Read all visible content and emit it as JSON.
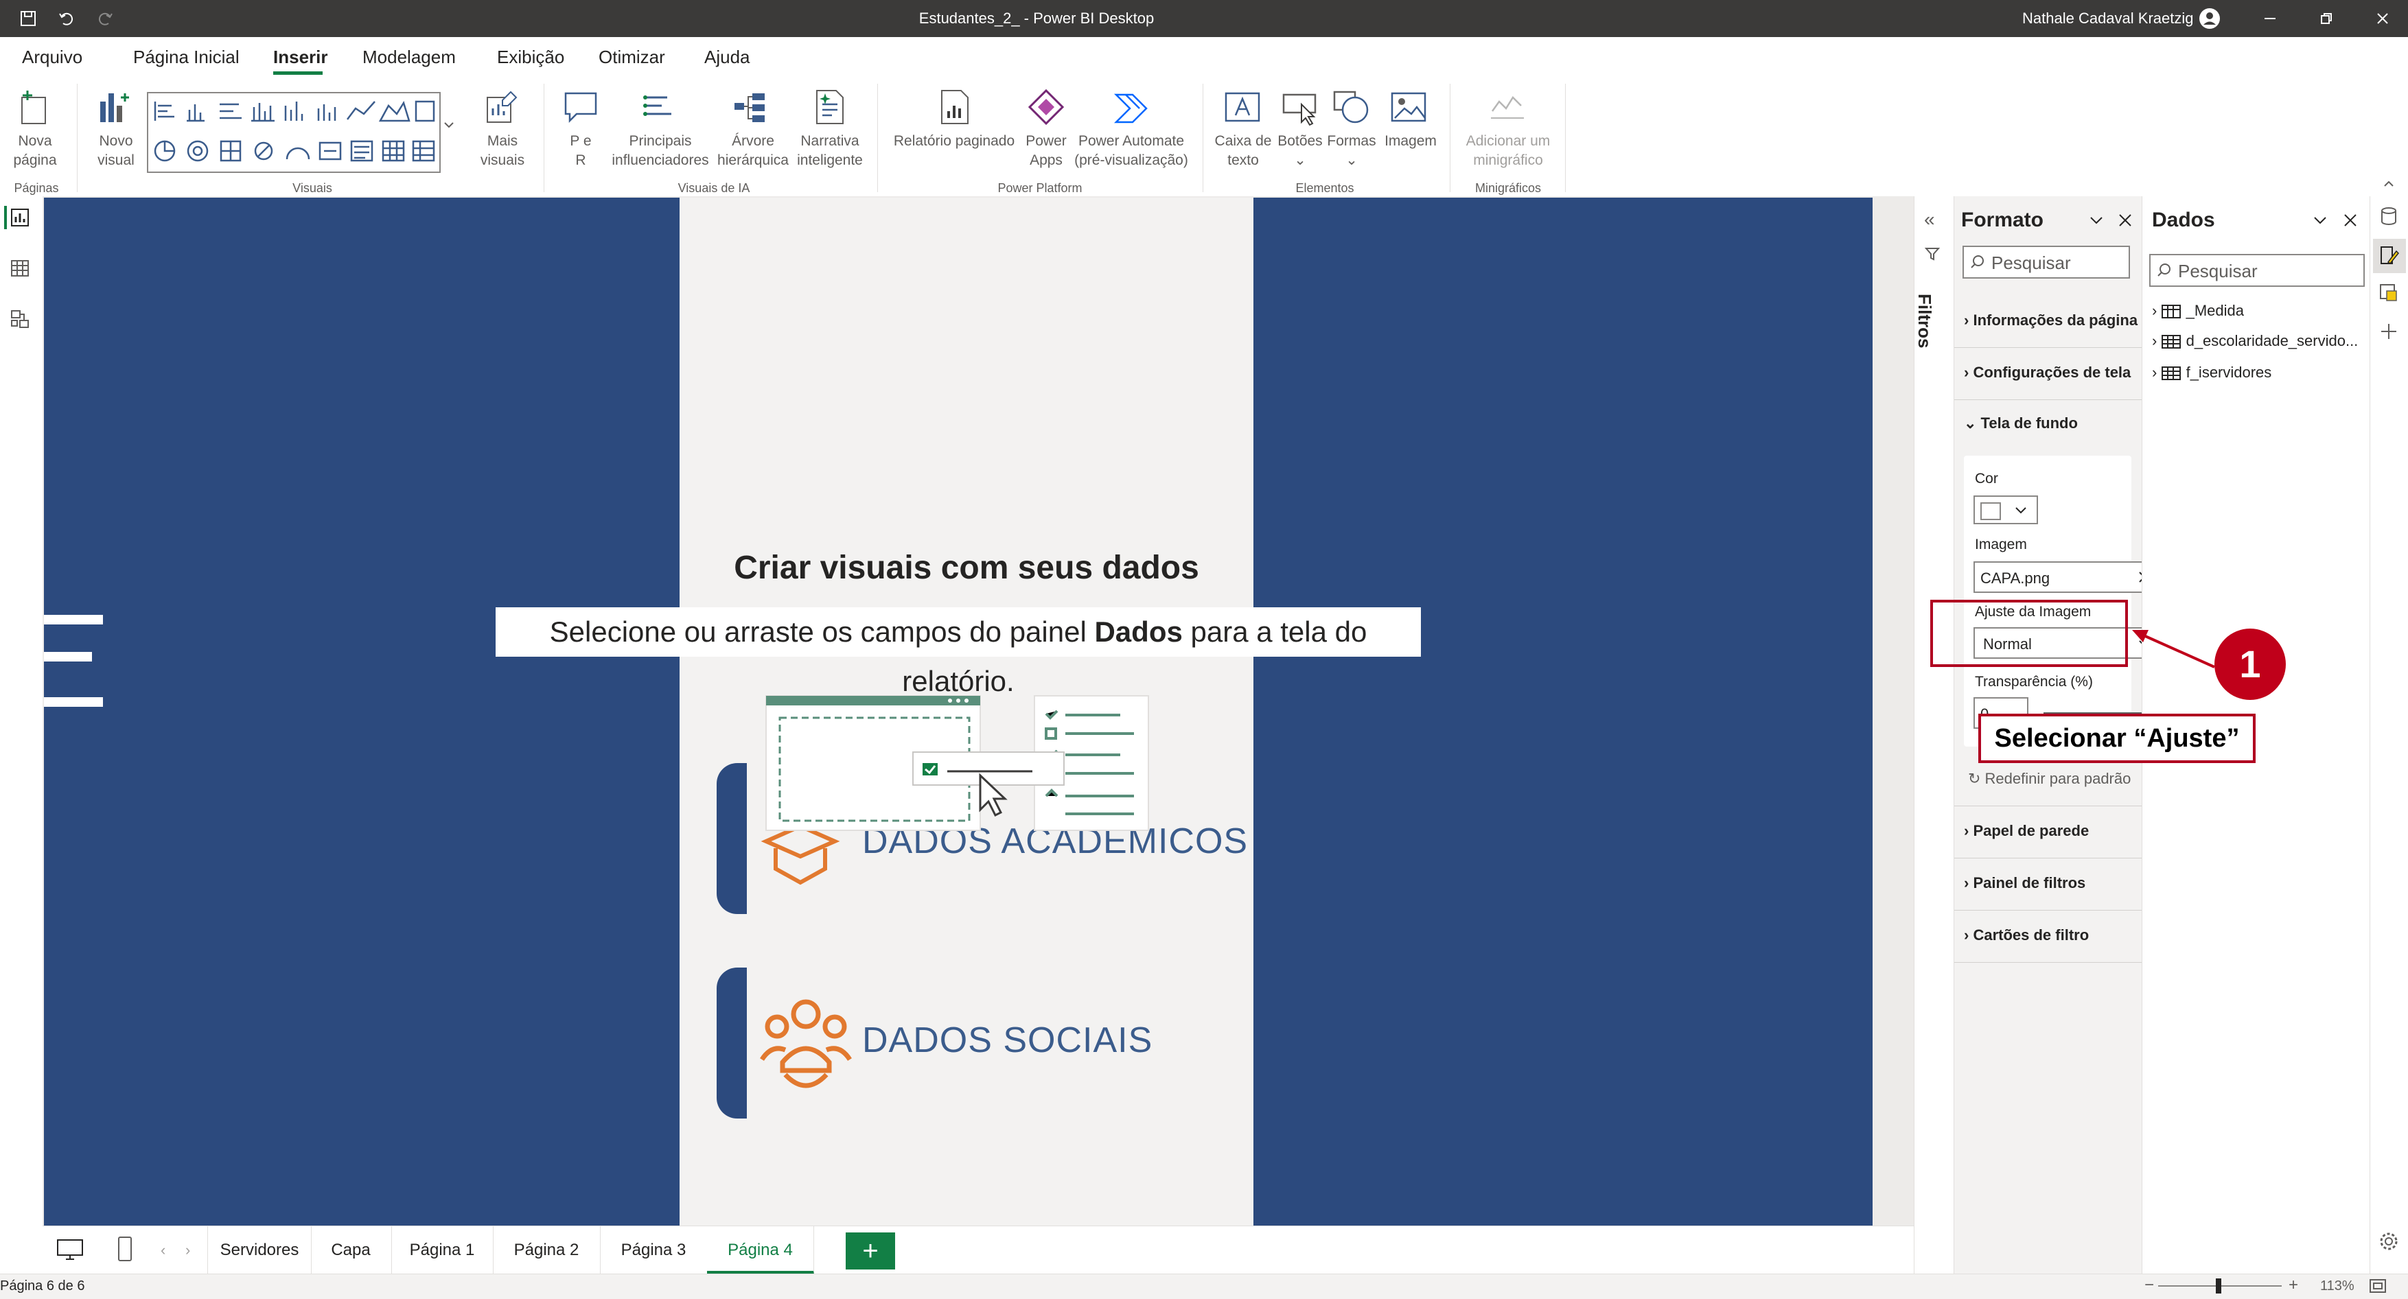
{
  "app": {
    "title": "Estudantes_2_ - Power BI Desktop",
    "user": "Nathale Cadaval Kraetzig"
  },
  "menu": {
    "items": [
      "Arquivo",
      "Página Inicial",
      "Inserir",
      "Modelagem",
      "Exibição",
      "Otimizar",
      "Ajuda"
    ],
    "active": "Inserir"
  },
  "ribbon": {
    "nova_pagina": [
      "Nova",
      "página"
    ],
    "novo_visual": [
      "Novo",
      "visual"
    ],
    "mais_visuais": [
      "Mais",
      "visuais"
    ],
    "pe_r": [
      "P e",
      "R"
    ],
    "principais": [
      "Principais",
      "influenciadores"
    ],
    "arvore": [
      "Árvore",
      "hierárquica"
    ],
    "narrativa": [
      "Narrativa",
      "inteligente"
    ],
    "relatorio": [
      "Relatório paginado",
      ""
    ],
    "power_apps": [
      "Power",
      "Apps"
    ],
    "power_automate": [
      "Power Automate",
      "(pré-visualização)"
    ],
    "caixa_texto": [
      "Caixa de",
      "texto"
    ],
    "botoes": "Botões",
    "formas": "Formas",
    "imagem": "Imagem",
    "minigrafico": [
      "Adicionar um",
      "minigráfico"
    ],
    "groups": {
      "paginas": "Páginas",
      "visuais": "Visuais",
      "visuais_ia": "Visuais de IA",
      "power_platform": "Power Platform",
      "elementos": "Elementos",
      "minigraficos": "Minigráficos"
    }
  },
  "canvas": {
    "cta_title": "Criar visuais com seus dados",
    "cta_sub_before": "Selecione ou arraste os campos do painel ",
    "cta_sub_bold": "Dados",
    "cta_sub_after": " para a tela do relatório.",
    "brand1": "DADOS ACADÊMICOS",
    "brand2": "DADOS SOCIAIS"
  },
  "pages": {
    "tabs": [
      "Servidores",
      "Capa",
      "Página 1",
      "Página 2",
      "Página 3",
      "Página 4"
    ],
    "active": "Página 4",
    "status": "Página 6 de 6",
    "zoom": "113%"
  },
  "filters": {
    "label": "Filtros"
  },
  "format_pane": {
    "title": "Formato",
    "search_placeholder": "Pesquisar",
    "sections": [
      "Informações da página",
      "Configurações de tela",
      "Tela de fundo",
      "Papel de parede",
      "Painel de filtros",
      "Cartões de filtro"
    ],
    "cor_label": "Cor",
    "imagem_label": "Imagem",
    "imagem_value": "CAPA.png",
    "ajuste_label": "Ajuste da Imagem",
    "ajuste_value": "Normal",
    "transparencia_label": "Transparência (%)",
    "transparencia_value": "0",
    "redefinir": "Redefinir para padrão"
  },
  "data_pane": {
    "title": "Dados",
    "search_placeholder": "Pesquisar",
    "items": [
      "_Medida",
      "d_escolaridade_servido...",
      "f_iservidores"
    ]
  },
  "annotation": {
    "number": "1",
    "label": "Selecionar “Ajuste”",
    "color": "#c0001a"
  }
}
